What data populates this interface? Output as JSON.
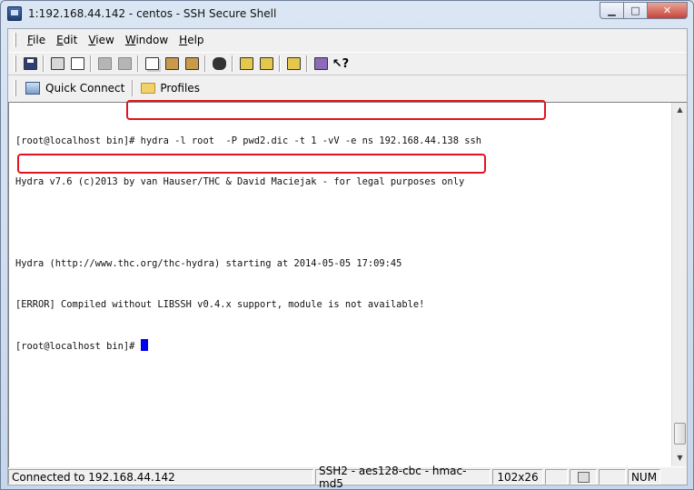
{
  "window": {
    "title": "1:192.168.44.142 - centos - SSH Secure Shell",
    "controls": [
      "minimize",
      "maximize",
      "close"
    ]
  },
  "menu": [
    {
      "label": "File",
      "accel": "F",
      "rest": "ile"
    },
    {
      "label": "Edit",
      "accel": "E",
      "rest": "dit"
    },
    {
      "label": "View",
      "accel": "V",
      "rest": "iew"
    },
    {
      "label": "Window",
      "accel": "W",
      "rest": "indow"
    },
    {
      "label": "Help",
      "accel": "H",
      "rest": "elp"
    }
  ],
  "toolbar": {
    "icons": [
      "save-icon",
      "print-icon",
      "print-preview-icon",
      "disabled-icon",
      "disabled-icon-2",
      "copy-icon",
      "paste-icon",
      "paste-special-icon",
      "find-icon",
      "new-terminal-icon",
      "new-file-transfer-icon",
      "settings-icon",
      "profiles-icon",
      "context-help-icon"
    ]
  },
  "linkbar": {
    "quick_connect": "Quick Connect",
    "profiles": "Profiles"
  },
  "terminal": {
    "lines": [
      "[root@localhost bin]# hydra -l root  -P pwd2.dic -t 1 -vV -e ns 192.168.44.138 ssh",
      "Hydra v7.6 (c)2013 by van Hauser/THC & David Maciejak - for legal purposes only",
      "",
      "Hydra (http://www.thc.org/thc-hydra) starting at 2014-05-05 17:09:45",
      "[ERROR] Compiled without LIBSSH v0.4.x support, module is not available!"
    ],
    "prompt": "[root@localhost bin]# "
  },
  "status": {
    "connection": "Connected to 192.168.44.142",
    "cipher": "SSH2 - aes128-cbc - hmac-md5",
    "size": "102x26",
    "num": "NUM"
  },
  "colors": {
    "highlight": "#e0141e",
    "cursor": "#0000ee"
  }
}
